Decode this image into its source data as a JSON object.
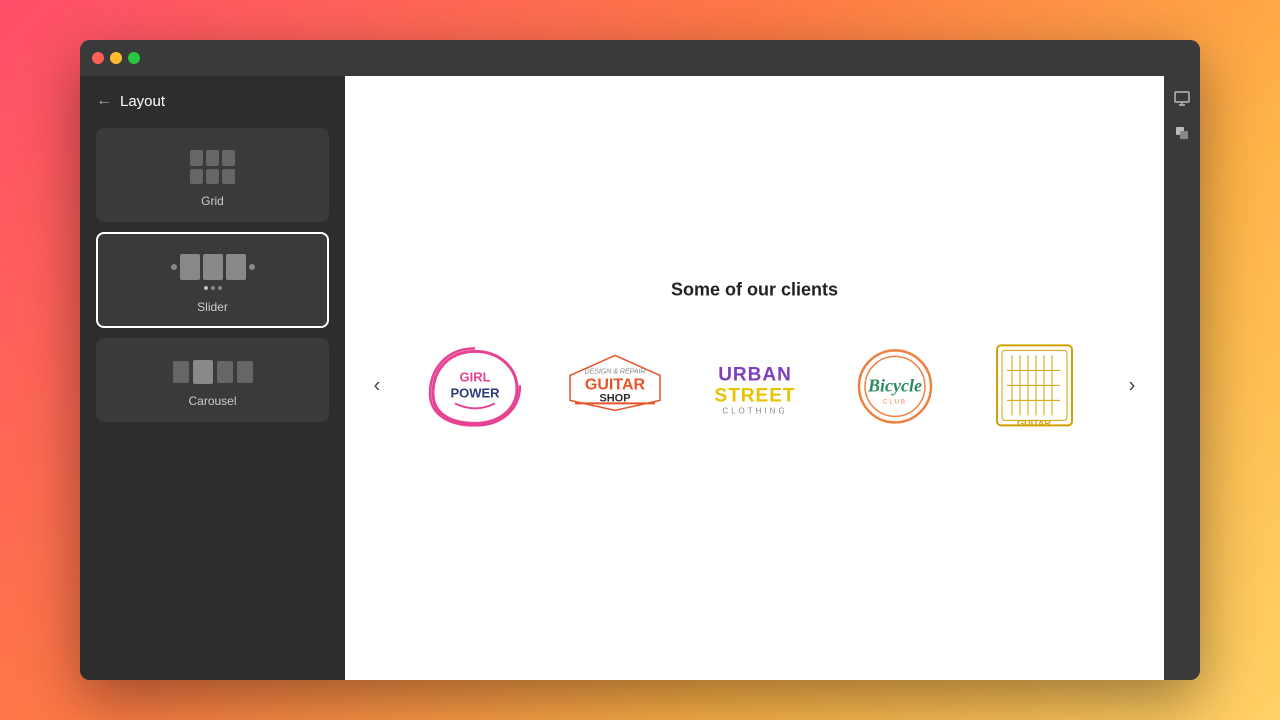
{
  "window": {
    "dots": [
      "red",
      "yellow",
      "green"
    ]
  },
  "sidebar": {
    "back_label": "←",
    "title": "Layout",
    "options": [
      {
        "id": "grid",
        "label": "Grid",
        "selected": false
      },
      {
        "id": "slider",
        "label": "Slider",
        "selected": true
      },
      {
        "id": "carousel",
        "label": "Carousel",
        "selected": false
      }
    ]
  },
  "main": {
    "clients_title": "Some of our clients",
    "clients": [
      {
        "id": "girl-power",
        "alt": "Girl Power"
      },
      {
        "id": "guitar-shop",
        "alt": "Guitar Shop"
      },
      {
        "id": "urban-street",
        "alt": "Urban Street Clothing"
      },
      {
        "id": "bicycle",
        "alt": "Bicycle"
      },
      {
        "id": "acoustic-guitar",
        "alt": "Acoustic Guitar"
      }
    ],
    "nav_prev": "‹",
    "nav_next": "›"
  },
  "toolbar": {
    "monitor_icon": "🖥",
    "paint_icon": "🎨"
  }
}
